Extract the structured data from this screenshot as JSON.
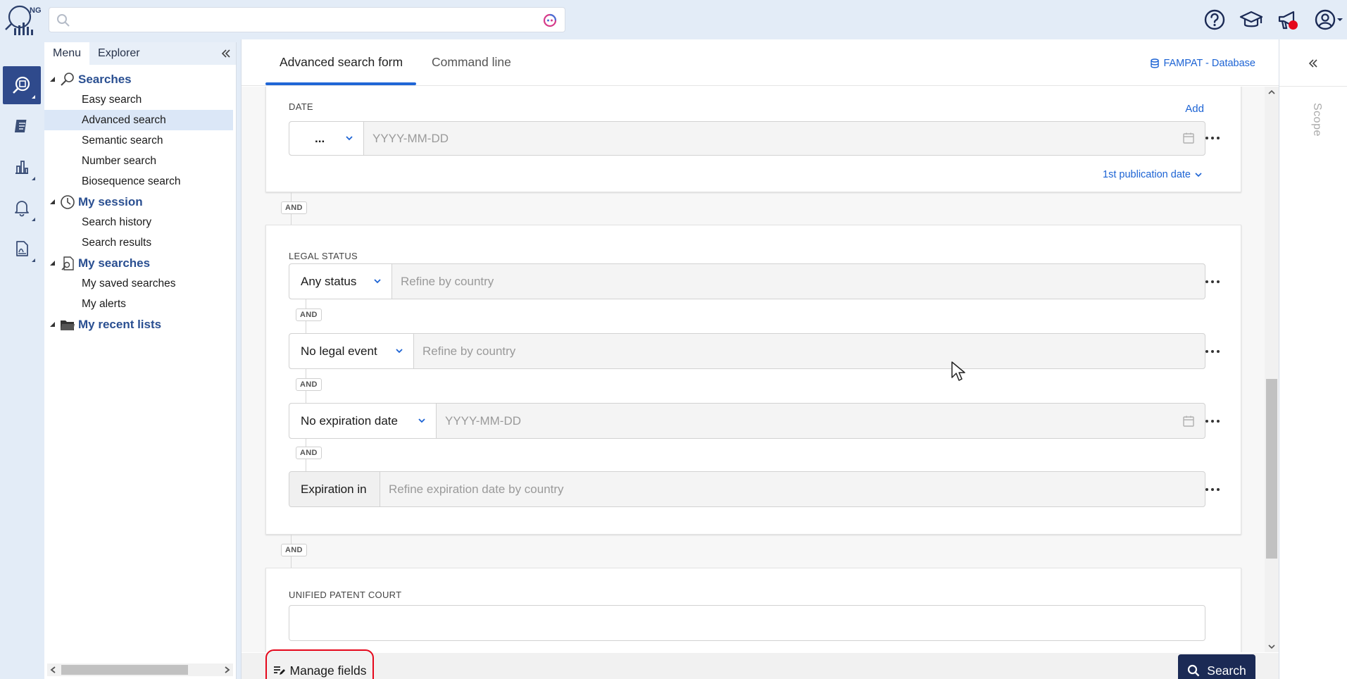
{
  "app": {
    "logo_text": "NG"
  },
  "topbar": {
    "search_placeholder": "",
    "icons": [
      "help-icon",
      "graduation-cap-icon",
      "megaphone-icon",
      "user-account-icon"
    ]
  },
  "rail": {
    "items": [
      "search-icon",
      "notes-icon",
      "analytics-icon",
      "alerts-icon",
      "document-icon"
    ]
  },
  "nav": {
    "tabs": [
      "Menu",
      "Explorer"
    ],
    "groups": [
      {
        "label": "Searches",
        "items": [
          "Easy search",
          "Advanced search",
          "Semantic search",
          "Number search",
          "Biosequence search"
        ]
      },
      {
        "label": "My session",
        "items": [
          "Search history",
          "Search results"
        ]
      },
      {
        "label": "My searches",
        "items": [
          "My saved searches",
          "My alerts"
        ]
      },
      {
        "label": "My recent lists",
        "items": []
      }
    ],
    "selected_item": "Advanced search"
  },
  "main": {
    "tabs": [
      "Advanced search form",
      "Command line"
    ],
    "active_tab": "Advanced search form",
    "database_link": "FAMPAT - Database",
    "and_label": "AND",
    "date_section": {
      "title": "DATE",
      "add_label": "Add",
      "operator": "...",
      "placeholder": "YYYY-MM-DD",
      "date_type": "1st publication date"
    },
    "legal_status_section": {
      "title": "LEGAL STATUS",
      "rows": [
        {
          "select": "Any status",
          "placeholder": "Refine by country"
        },
        {
          "select": "No legal event",
          "placeholder": "Refine by country"
        },
        {
          "select": "No expiration date",
          "placeholder": "YYYY-MM-DD"
        },
        {
          "select": "Expiration in",
          "placeholder": "Refine expiration date by country"
        }
      ]
    },
    "upc_section": {
      "title": "UNIFIED PATENT COURT"
    },
    "footer": {
      "manage_fields_label": "Manage fields",
      "search_label": "Search"
    }
  },
  "scope": {
    "label": "Scope"
  },
  "colors": {
    "accent": "#2066d6",
    "primary_button": "#1b2a55",
    "highlight": "#e5071b",
    "nav_header": "#2a4f91"
  }
}
